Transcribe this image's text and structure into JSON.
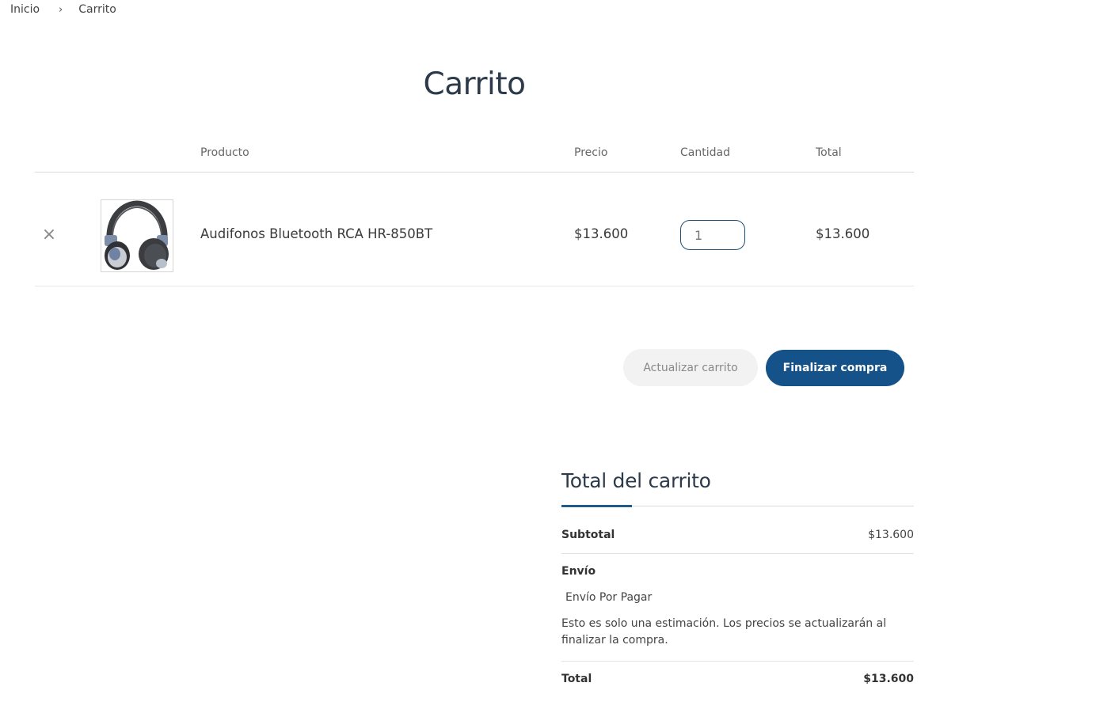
{
  "breadcrumb": {
    "home": "Inicio",
    "separator": "›",
    "current": "Carrito"
  },
  "page": {
    "title": "Carrito"
  },
  "cart_table": {
    "headers": {
      "product": "Producto",
      "price": "Precio",
      "quantity": "Cantidad",
      "total": "Total"
    },
    "items": [
      {
        "remove_icon": "×",
        "thumbnail_icon": "headphones-image",
        "name": "Audifonos Bluetooth RCA HR-850BT",
        "price": "$13.600",
        "quantity": "1",
        "line_total": "$13.600"
      }
    ]
  },
  "actions": {
    "update_label": "Actualizar carrito",
    "checkout_label": "Finalizar compra"
  },
  "totals": {
    "title": "Total del carrito",
    "subtotal_label": "Subtotal",
    "subtotal_value": "$13.600",
    "shipping_label": "Envío",
    "shipping_method": "Envío Por Pagar",
    "shipping_note": "Esto es solo una estimación. Los precios se actualizarán al finalizar la compra.",
    "total_label": "Total",
    "total_value": "$13.600"
  },
  "colors": {
    "primary": "#15528a",
    "input_border": "#1f4f72",
    "title": "#2c3a4b"
  }
}
